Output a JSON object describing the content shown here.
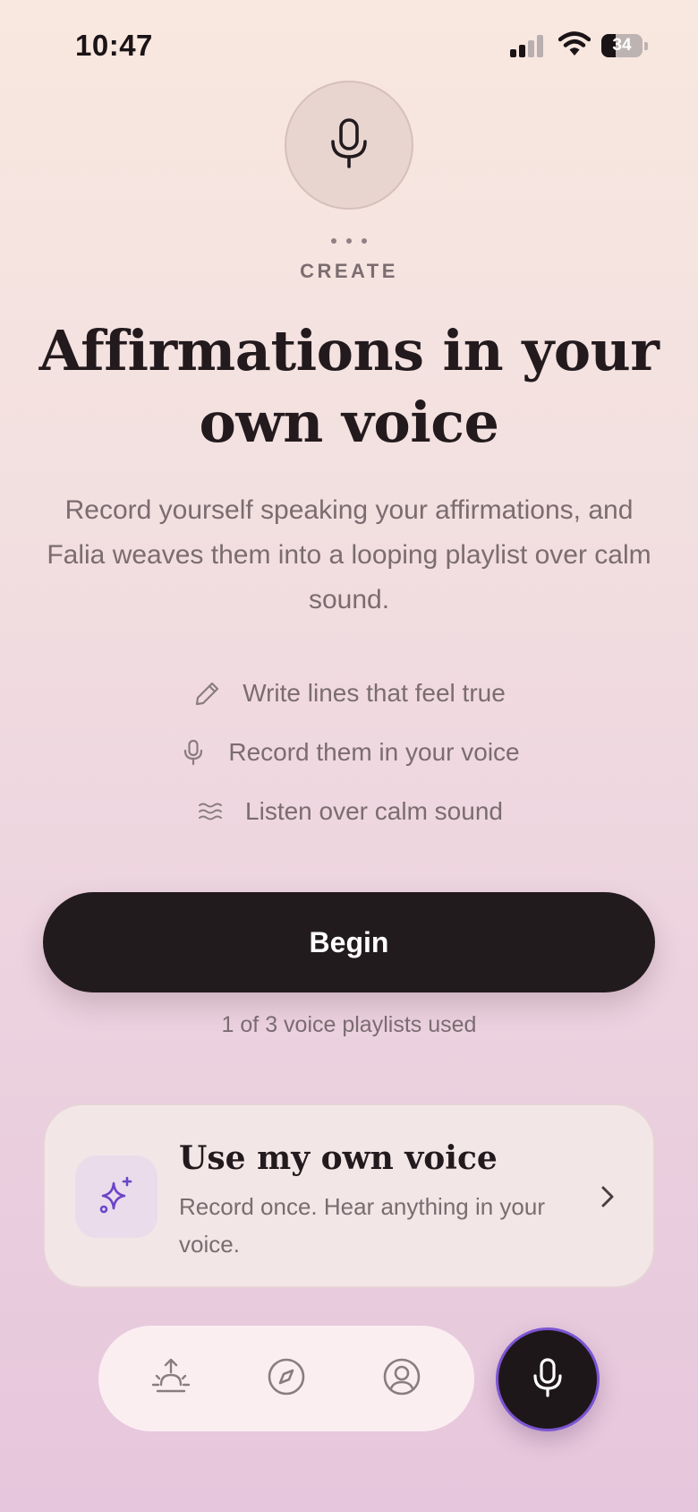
{
  "status_bar": {
    "time": "10:47",
    "battery_level": "34",
    "battery_fraction": 0.34
  },
  "hero": {
    "icon": "microphone-icon",
    "eyebrow": "CREATE",
    "title": "Affirmations in your own voice",
    "description": "Record yourself speaking your affirmations, and Falia weaves them into a looping playlist over calm sound."
  },
  "features": [
    {
      "icon": "pencil-icon",
      "label": "Write lines that feel true"
    },
    {
      "icon": "microphone-icon",
      "label": "Record them in your voice"
    },
    {
      "icon": "waves-icon",
      "label": "Listen over calm sound"
    }
  ],
  "cta": {
    "label": "Begin",
    "usage_note": "1 of 3 voice playlists used"
  },
  "voice_card": {
    "icon": "sparkles-icon",
    "title": "Use my own voice",
    "subtitle": "Record once. Hear anything in your voice.",
    "chevron": "chevron-right-icon"
  },
  "tab_bar": {
    "tabs": [
      {
        "icon": "sunrise-icon"
      },
      {
        "icon": "compass-icon"
      },
      {
        "icon": "profile-icon"
      }
    ],
    "record_icon": "microphone-icon"
  },
  "colors": {
    "accent_purple": "#7b55d2",
    "button_dark": "#221b1e",
    "text_muted": "#7a6c70"
  }
}
